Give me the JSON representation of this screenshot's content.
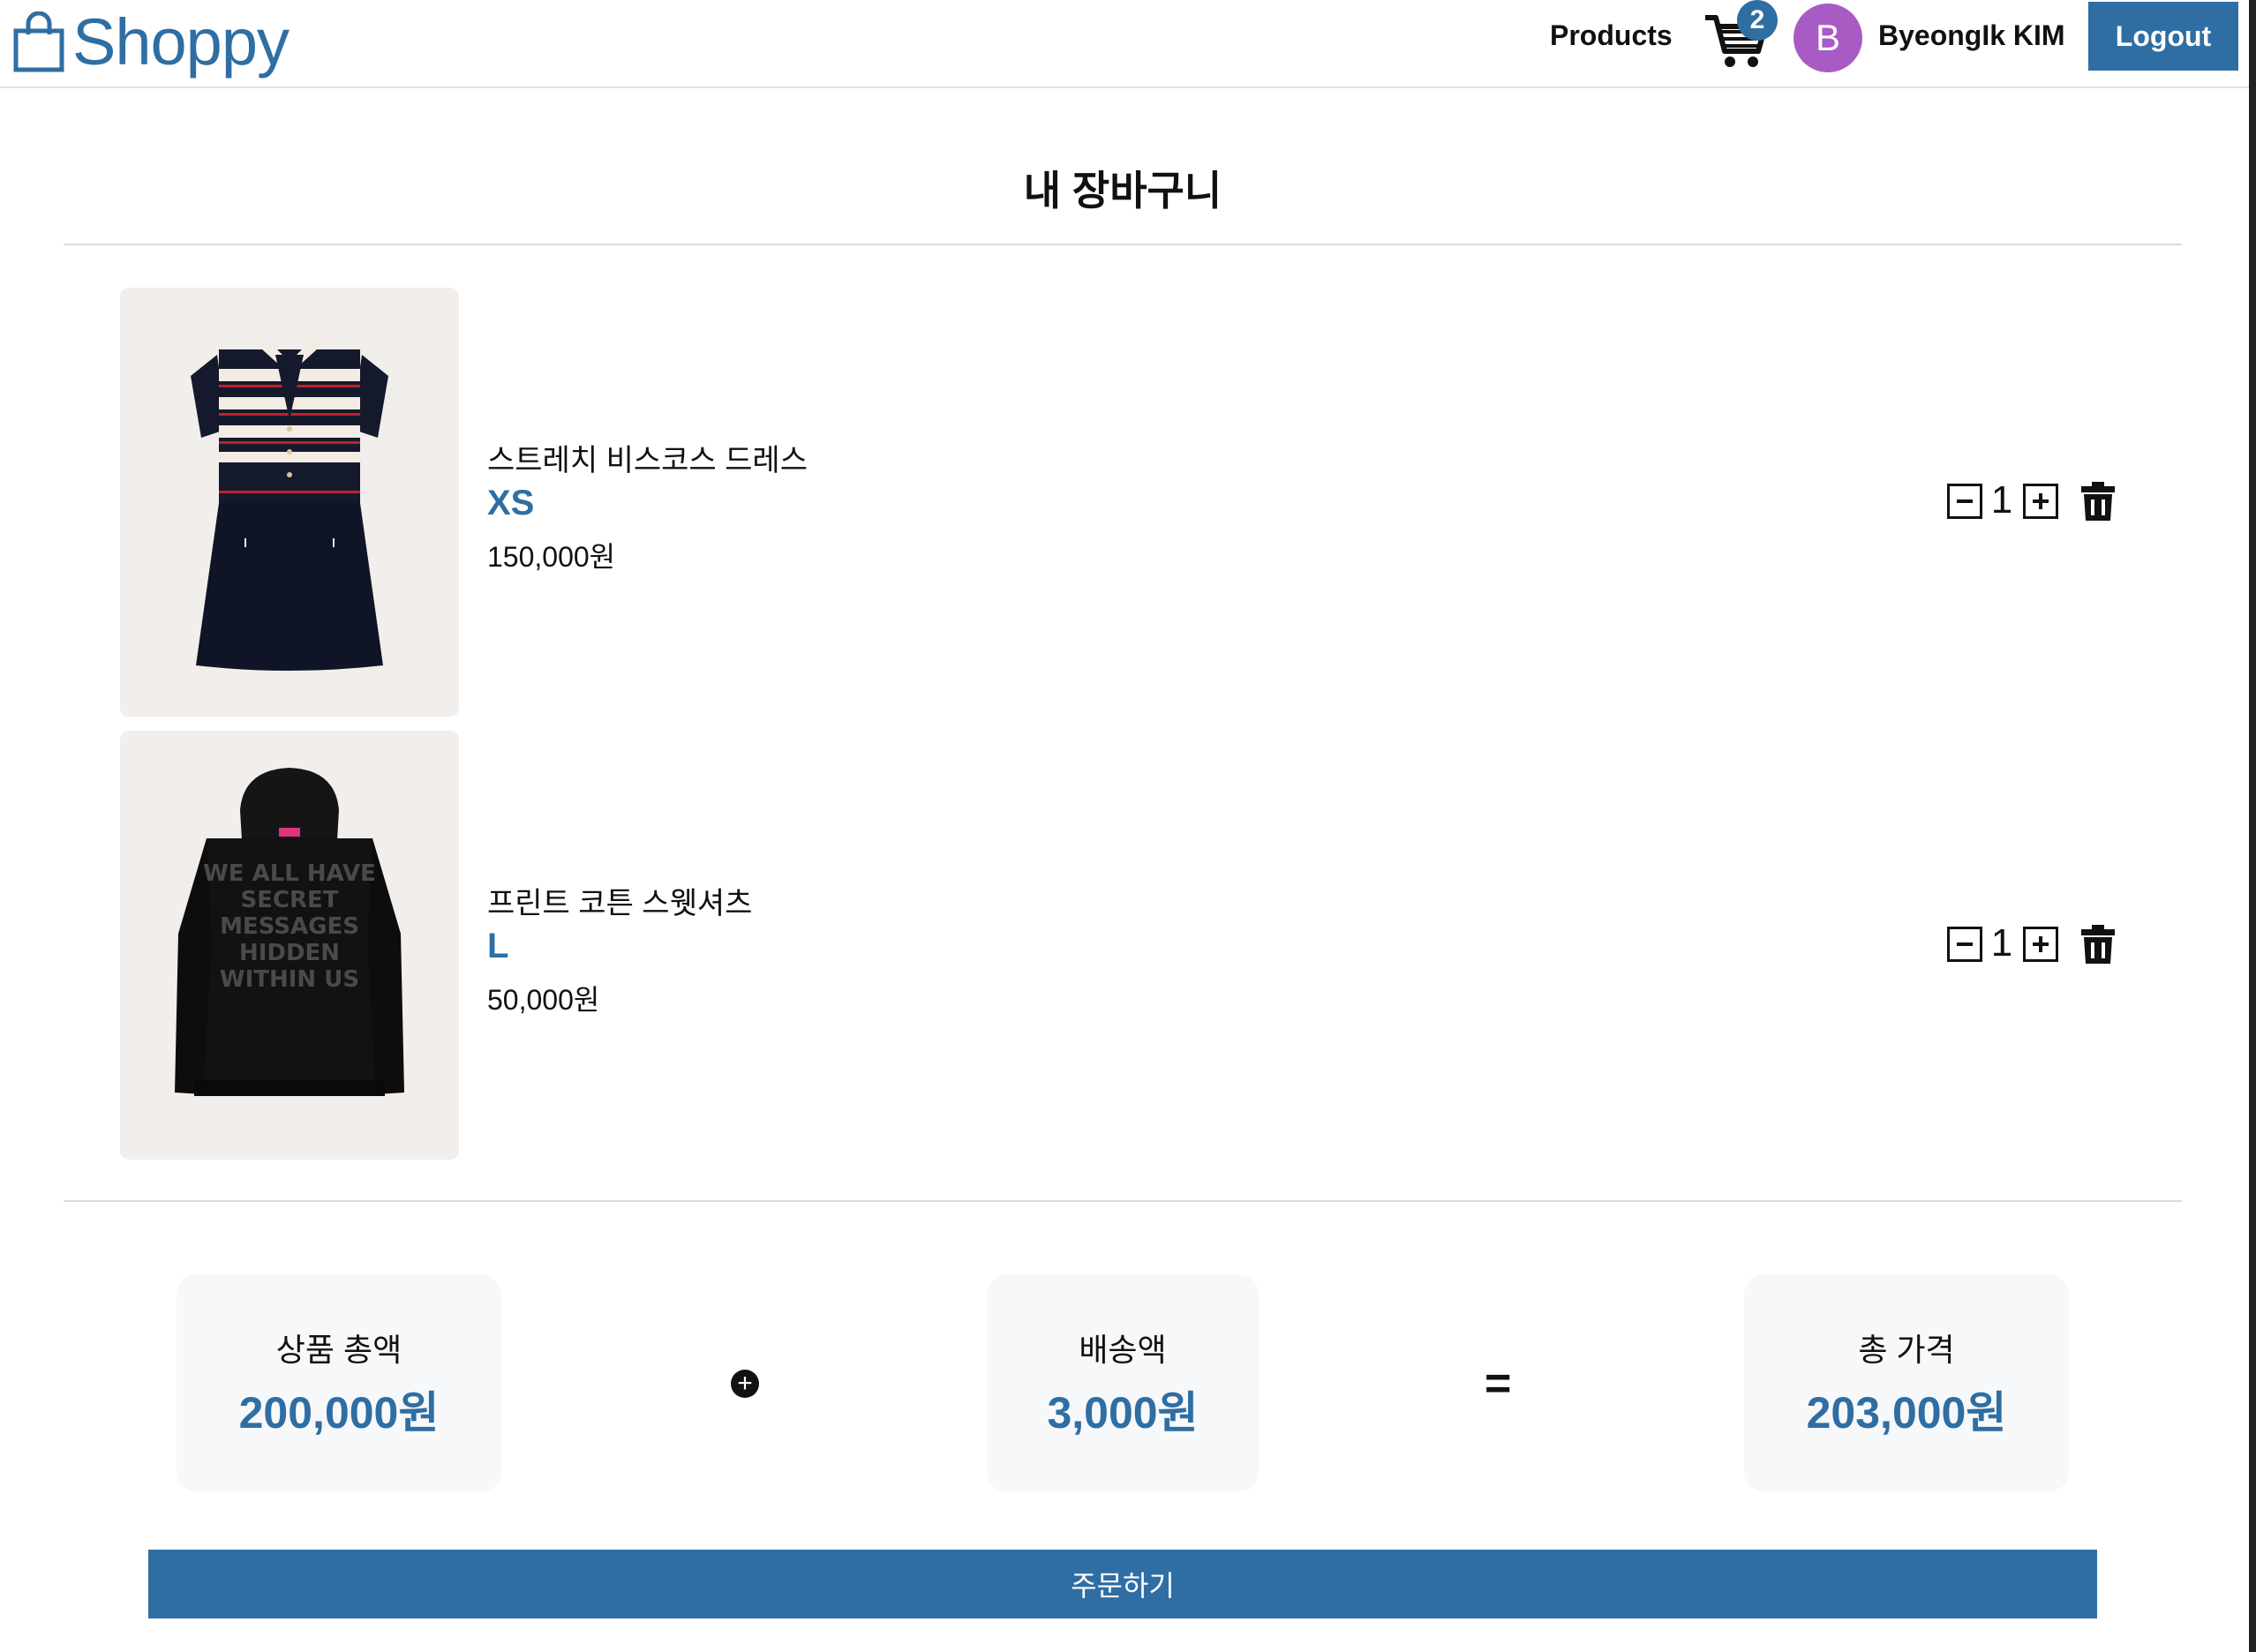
{
  "header": {
    "logo_text": "Shoppy",
    "nav_products": "Products",
    "cart_count": "2",
    "avatar_initial": "B",
    "username": "ByeongIk KIM",
    "logout_label": "Logout"
  },
  "page": {
    "title": "내 장바구니"
  },
  "cart": {
    "items": [
      {
        "name": "스트레치 비스코스 드레스",
        "size": "XS",
        "price": "150,000원",
        "quantity": "1",
        "image": "striped-knit-dress"
      },
      {
        "name": "프린트 코튼 스웻셔츠",
        "size": "L",
        "price": "50,000원",
        "quantity": "1",
        "image": "black-print-hoodie",
        "print_text": [
          "WE ALL HAVE",
          "SECRET",
          "MESSAGES",
          "HIDDEN",
          "WITHIN US"
        ]
      }
    ]
  },
  "summary": {
    "subtotal_label": "상품 총액",
    "subtotal_value": "200,000원",
    "shipping_label": "배송액",
    "shipping_value": "3,000원",
    "total_label": "총 가격",
    "total_value": "203,000원",
    "plus_symbol": "+",
    "equals_symbol": "="
  },
  "order_button_label": "주문하기",
  "colors": {
    "accent": "#2f6ea3",
    "avatar": "#a95bc4",
    "card_bg": "#f7f8fa",
    "thumb_bg": "#f1eeeb"
  },
  "icons": [
    "shopping-bag-icon",
    "cart-icon",
    "minus-square-icon",
    "plus-square-icon",
    "trash-icon",
    "plus-circle-icon"
  ]
}
